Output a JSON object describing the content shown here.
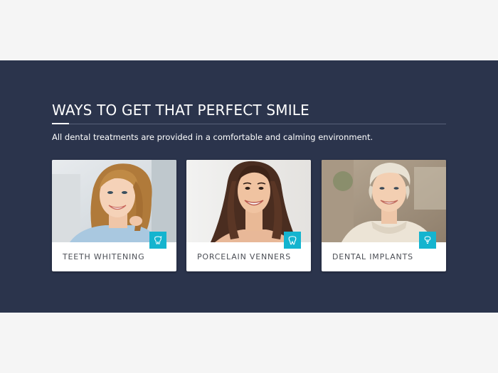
{
  "section": {
    "heading": "WAYS TO GET THAT PERFECT SMILE",
    "subtitle": "All dental treatments are provided in a comfortable and calming environment."
  },
  "cards": [
    {
      "label": "TEETH WHITENING",
      "icon": "sparkle-tooth-icon"
    },
    {
      "label": "PORCELAIN VENNERS",
      "icon": "tooth-icon"
    },
    {
      "label": "DENTAL IMPLANTS",
      "icon": "implant-icon"
    }
  ],
  "colors": {
    "section_bg": "#2b344c",
    "accent": "#14b4cf",
    "page_bg": "#f5f5f5",
    "card_text": "#4c4f56"
  }
}
